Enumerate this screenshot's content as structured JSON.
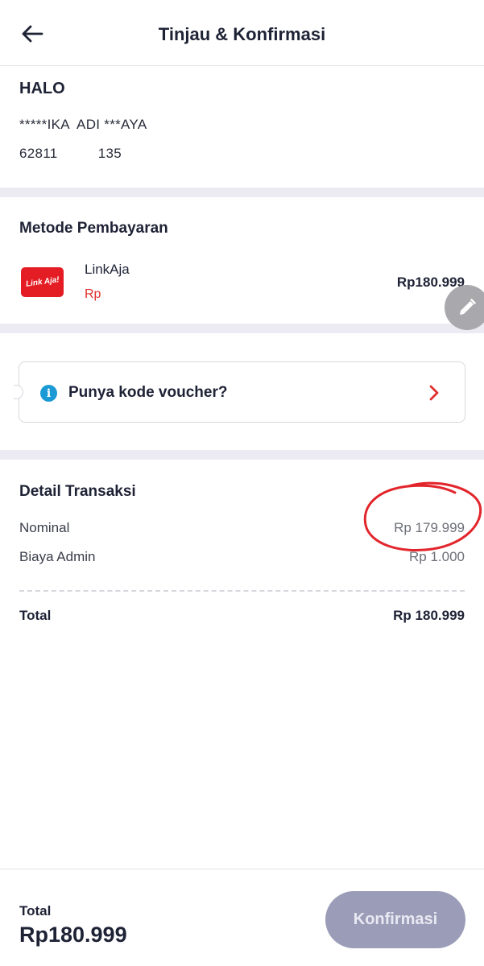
{
  "header": {
    "title": "Tinjau & Konfirmasi"
  },
  "account": {
    "product": "HALO",
    "name": "*****IKA  ADI ***AYA",
    "number": "62811          135"
  },
  "payment": {
    "title": "Metode Pembayaran",
    "logo_text": "Link Aja!",
    "method_name": "LinkAja",
    "balance": "Rp",
    "amount": "Rp180.999"
  },
  "voucher": {
    "label": "Punya kode voucher?"
  },
  "detail": {
    "title": "Detail Transaksi",
    "rows": [
      {
        "label": "Nominal",
        "value": "Rp 179.999"
      },
      {
        "label": "Biaya Admin",
        "value": "Rp 1.000"
      }
    ],
    "total_label": "Total",
    "total_value": "Rp 180.999"
  },
  "footer": {
    "total_label": "Total",
    "total_amount": "Rp180.999",
    "confirm_label": "Konfirmasi"
  },
  "colors": {
    "accent_red": "#e0312f",
    "logo_red": "#e41c24",
    "info_blue": "#1b9ad6",
    "button_disabled": "#9b9db8",
    "divider": "#ecebf4"
  },
  "icons": [
    "back-arrow-icon",
    "linkaja-logo",
    "info-icon",
    "chevron-right-icon",
    "pencil-icon"
  ]
}
